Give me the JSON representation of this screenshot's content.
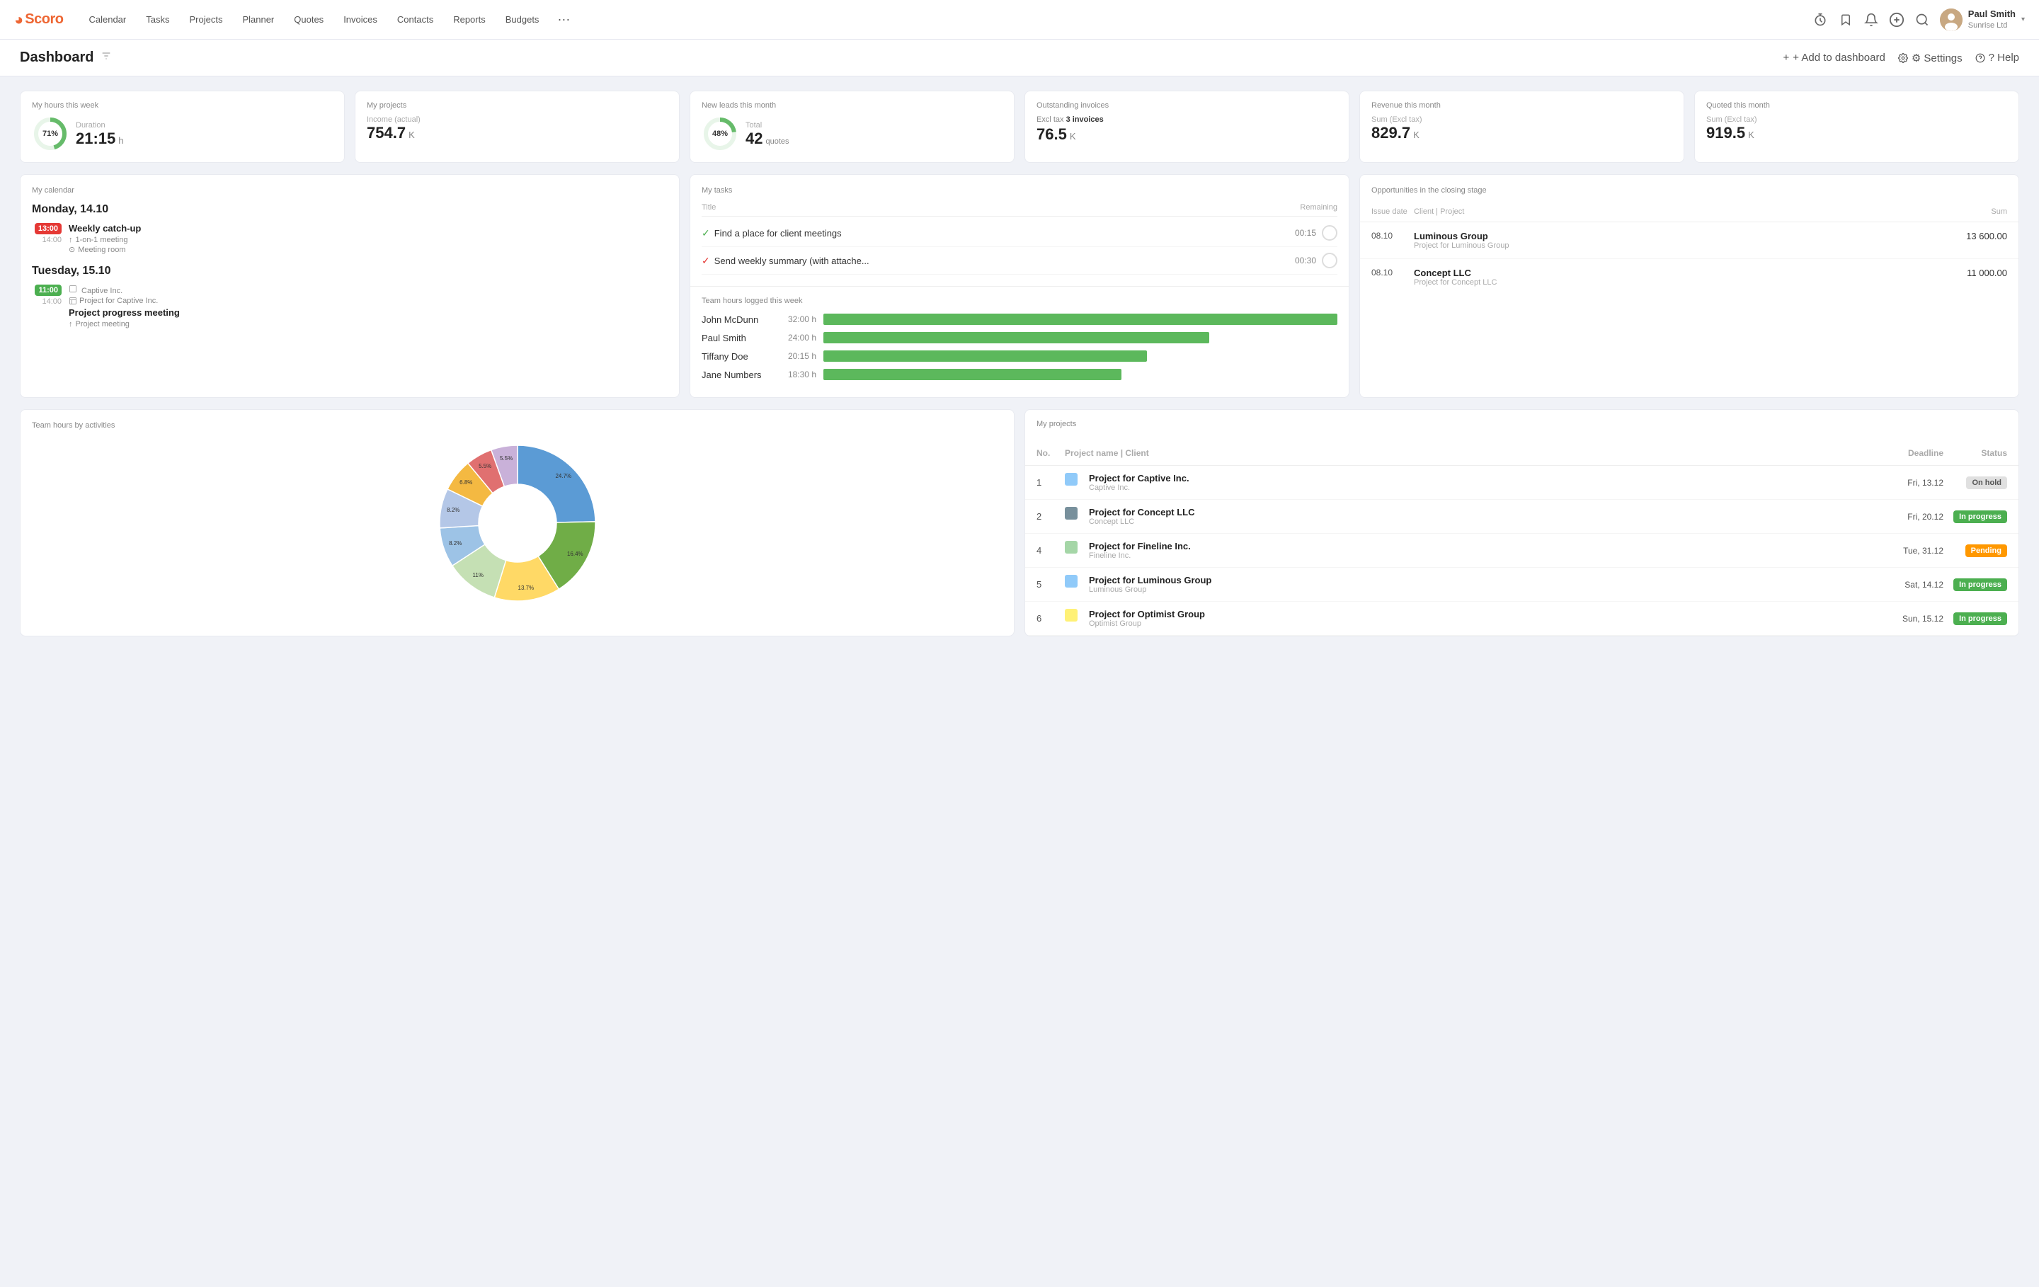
{
  "logo": {
    "text": "Scoro"
  },
  "nav": {
    "items": [
      {
        "label": "Calendar"
      },
      {
        "label": "Tasks"
      },
      {
        "label": "Projects"
      },
      {
        "label": "Planner"
      },
      {
        "label": "Quotes"
      },
      {
        "label": "Invoices"
      },
      {
        "label": "Contacts"
      },
      {
        "label": "Reports"
      },
      {
        "label": "Budgets"
      }
    ],
    "more": "···"
  },
  "header_actions": {
    "timer_icon": "⏱",
    "bookmark_icon": "🔖",
    "bell_icon": "🔔",
    "plus_icon": "⊕",
    "search_icon": "🔍"
  },
  "user": {
    "name": "Paul Smith",
    "company": "Sunrise Ltd",
    "avatar_initials": "PS"
  },
  "dashboard": {
    "title": "Dashboard",
    "add_label": "+ Add to dashboard",
    "settings_label": "⚙ Settings",
    "help_label": "? Help"
  },
  "stats": [
    {
      "label": "My hours this week",
      "type": "donut",
      "pct": 71,
      "value": "21:15",
      "unit": "h",
      "sub_label": "Duration"
    },
    {
      "label": "My projects",
      "value": "754.7",
      "unit": "K",
      "sub_label": "Income (actual)"
    },
    {
      "label": "New leads this month",
      "type": "donut",
      "pct": 48,
      "value": "42",
      "unit": "quotes",
      "sub_label": "Total"
    },
    {
      "label": "Outstanding invoices",
      "value": "76.5",
      "unit": "K",
      "sub_label": "Excl tax",
      "badge": "3 invoices"
    },
    {
      "label": "Revenue this month",
      "value": "829.7",
      "unit": "K",
      "sub_label": "Sum (Excl tax)"
    },
    {
      "label": "Quoted this month",
      "value": "919.5",
      "unit": "K",
      "sub_label": "Sum (Excl tax)"
    }
  ],
  "calendar": {
    "section_title": "My calendar",
    "day1": "Monday, 14.10",
    "day2": "Tuesday, 15.10",
    "events": [
      {
        "time_start": "13:00",
        "time_end": "14:00",
        "color": "red",
        "title": "Weekly catch-up",
        "meta1": "1-on-1 meeting",
        "meta2": "Meeting room"
      }
    ],
    "events2": [
      {
        "time_start": "11:00",
        "time_end": "14:00",
        "color": "green",
        "company": "Captive Inc.",
        "project": "Project for Captive Inc.",
        "title": "Project progress meeting",
        "meta1": "Project meeting"
      }
    ]
  },
  "tasks": {
    "section_title": "My tasks",
    "col_title": "Title",
    "col_remaining": "Remaining",
    "items": [
      {
        "check": "ok",
        "title": "Find a place for client meetings",
        "time": "00:15"
      },
      {
        "check": "red",
        "title": "Send weekly summary (with attache...",
        "time": "00:30"
      }
    ]
  },
  "team_hours": {
    "section_title": "Team hours logged this week",
    "max_hours": 32,
    "members": [
      {
        "name": "John McDunn",
        "hours": "32:00 h",
        "value": 32
      },
      {
        "name": "Paul Smith",
        "hours": "24:00 h",
        "value": 24
      },
      {
        "name": "Tiffany Doe",
        "hours": "20:15 h",
        "value": 20.25
      },
      {
        "name": "Jane Numbers",
        "hours": "18:30 h",
        "value": 18.5
      }
    ]
  },
  "opportunities": {
    "section_title": "Opportunities in the closing stage",
    "col_date": "Issue date",
    "col_client": "Client | Project",
    "col_sum": "Sum",
    "items": [
      {
        "date": "08.10",
        "client": "Luminous Group",
        "project": "Project for Luminous Group",
        "sum": "13 600.00"
      },
      {
        "date": "08.10",
        "client": "Concept LLC",
        "project": "Project for Concept LLC",
        "sum": "11 000.00"
      }
    ]
  },
  "pie_chart": {
    "section_title": "Team hours by activities",
    "segments": [
      {
        "label": "24.7%",
        "value": 24.7,
        "color": "#5b9bd5"
      },
      {
        "label": "16.4%",
        "value": 16.4,
        "color": "#70ad47"
      },
      {
        "label": "13.7%",
        "value": 13.7,
        "color": "#ffd966"
      },
      {
        "label": "11%",
        "value": 11,
        "color": "#c5e0b4"
      },
      {
        "label": "8.2%",
        "value": 8.2,
        "color": "#9dc3e6"
      },
      {
        "label": "8.2%",
        "value": 8.2,
        "color": "#b4c7e7"
      },
      {
        "label": "6.8%",
        "value": 6.8,
        "color": "#f4b942"
      },
      {
        "label": "5.5%",
        "value": 5.5,
        "color": "#e07070"
      },
      {
        "label": "5.5%",
        "value": 5.5,
        "color": "#c9b1d9"
      }
    ]
  },
  "projects": {
    "section_title": "My projects",
    "col_no": "No.",
    "col_name": "Project name | Client",
    "col_deadline": "Deadline",
    "col_status": "Status",
    "items": [
      {
        "no": 1,
        "name": "Project for Captive Inc.",
        "client": "Captive Inc.",
        "icon_color": "#90caf9",
        "deadline": "Fri, 13.12",
        "status": "On hold",
        "status_type": "hold"
      },
      {
        "no": 2,
        "name": "Project for Concept LLC",
        "client": "Concept LLC",
        "icon_color": "#78909c",
        "deadline": "Fri, 20.12",
        "status": "In progress",
        "status_type": "progress"
      },
      {
        "no": 4,
        "name": "Project for Fineline Inc.",
        "client": "Fineline Inc.",
        "icon_color": "#a5d6a7",
        "deadline": "Tue, 31.12",
        "status": "Pending",
        "status_type": "pending"
      },
      {
        "no": 5,
        "name": "Project for Luminous Group",
        "client": "Luminous Group",
        "icon_color": "#90caf9",
        "deadline": "Sat, 14.12",
        "status": "In progress",
        "status_type": "progress"
      },
      {
        "no": 6,
        "name": "Project for Optimist Group",
        "client": "Optimist Group",
        "icon_color": "#fff176",
        "deadline": "Sun, 15.12",
        "status": "In progress",
        "status_type": "progress"
      }
    ]
  }
}
